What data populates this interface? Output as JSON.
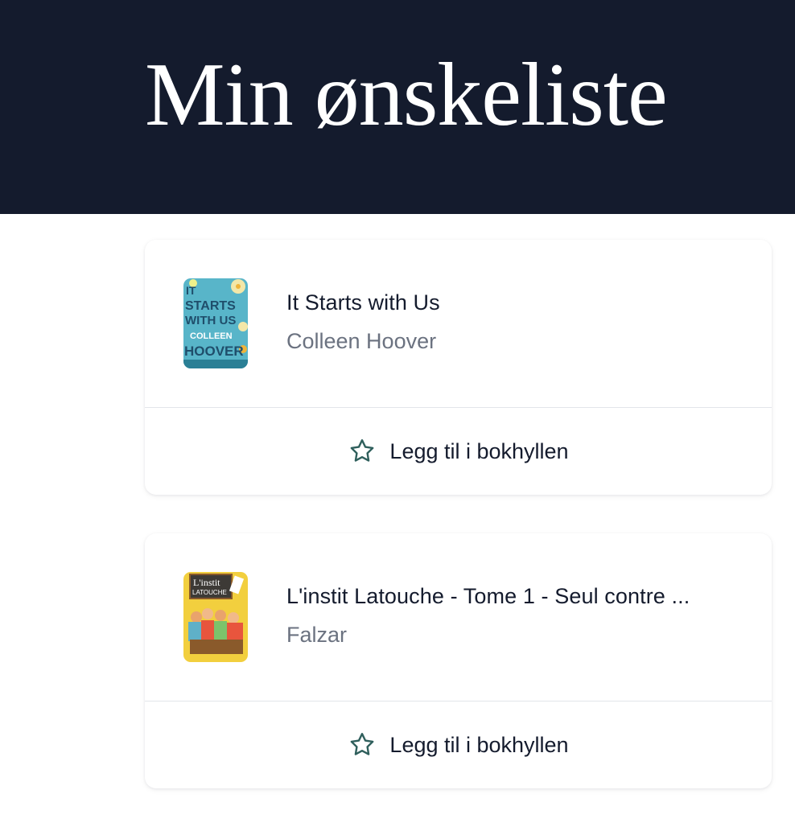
{
  "header": {
    "title": "Min ønskeliste",
    "background": "#141b2d"
  },
  "books": [
    {
      "title": "It Starts with Us",
      "author": "Colleen Hoover",
      "cover_text": [
        "IT",
        "STARTS",
        "WITH US",
        "COLLEEN",
        "HOOVER"
      ],
      "action_label": "Legg til i bokhyllen",
      "action_icon": "star-outline-icon"
    },
    {
      "title": "L'instit Latouche - Tome 1 - Seul contre ...",
      "author": "Falzar",
      "cover_text": [
        "L'instit",
        "LATOUCHE"
      ],
      "action_label": "Legg til i bokhyllen",
      "action_icon": "star-outline-icon"
    }
  ],
  "colors": {
    "title_text": "#141b2d",
    "author_text": "#6b7280",
    "star_outline": "#2f5f5c",
    "divider": "#e3e5ea"
  }
}
